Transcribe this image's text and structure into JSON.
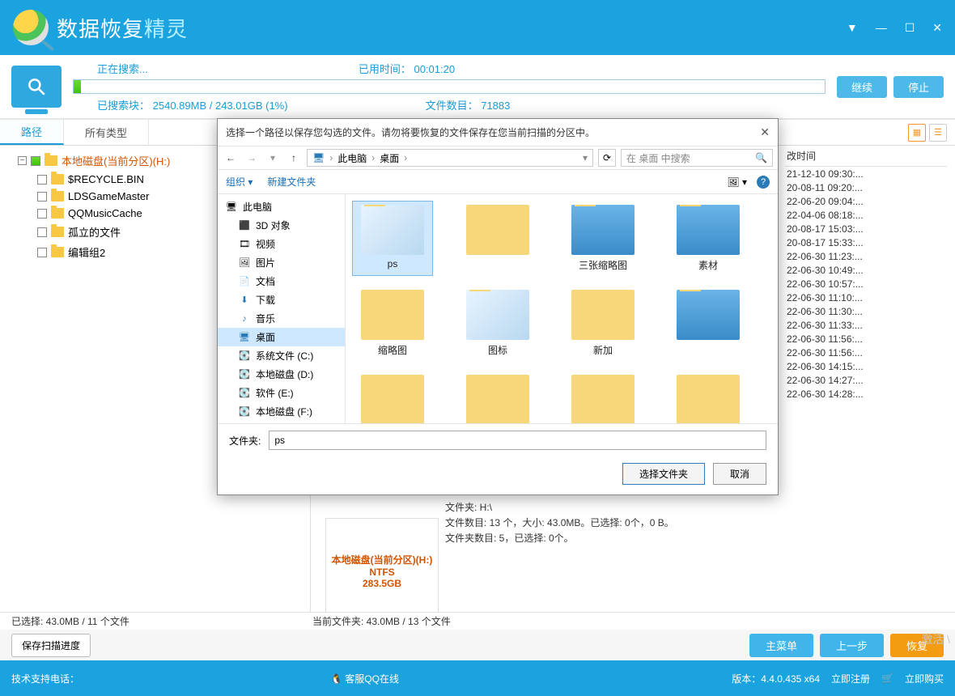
{
  "titlebar": {
    "app_name_a": "数据恢复",
    "app_name_b": "精灵"
  },
  "progress": {
    "searching": "正在搜索...",
    "elapsed_lbl": "已用时间：",
    "elapsed_val": "00:01:20",
    "blocks_lbl": "已搜索块：",
    "blocks_val": "2540.89MB / 243.01GB (1%)",
    "files_lbl": "文件数目：",
    "files_val": "71883",
    "btn_continue": "继续",
    "btn_stop": "停止"
  },
  "tabs": {
    "path": "路径",
    "all_types": "所有类型"
  },
  "tree": {
    "root": "本地磁盘(当前分区)(H:)",
    "n1": "$RECYCLE.BIN",
    "n2": "LDSGameMaster",
    "n3": "QQMusicCache",
    "n4": "孤立的文件",
    "n5": "编辑组2"
  },
  "times": {
    "header": "改时间",
    "rows": [
      "21-12-10 09:30:...",
      "20-08-11 09:20:...",
      "22-06-20 09:04:...",
      "22-04-06 08:18:...",
      "20-08-17 15:03:...",
      "20-08-17 15:33:...",
      "22-06-30 11:23:...",
      "22-06-30 10:49:...",
      "22-06-30 10:57:...",
      "22-06-30 11:10:...",
      "22-06-30 11:30:...",
      "22-06-30 11:33:...",
      "22-06-30 11:56:...",
      "22-06-30 11:56:...",
      "22-06-30 14:15:...",
      "22-06-30 14:27:...",
      "22-06-30 14:28:..."
    ]
  },
  "disk_card": {
    "l1": "本地磁盘(当前分区)(H:)",
    "l2": "NTFS",
    "l3": "283.5GB"
  },
  "info": {
    "l1": "文件夹: H:\\",
    "l2": "文件数目: 13 个，大小: 43.0MB。已选择: 0个，0 B。",
    "l3": "文件夹数目: 5，已选择: 0个。"
  },
  "status": {
    "selected": "已选择: 43.0MB / 11 个文件",
    "current": "当前文件夹: 43.0MB / 13 个文件"
  },
  "actions": {
    "save_progress": "保存扫描进度",
    "main_menu": "主菜单",
    "prev": "上一步",
    "recover": "恢复"
  },
  "footer": {
    "tech": "技术支持电话：",
    "qq": "客服QQ在线",
    "version": "版本：4.4.0.435 x64",
    "register": "立即注册",
    "buy": "立即购买",
    "activate": "激活 \\"
  },
  "dialog": {
    "title": "选择一个路径以保存您勾选的文件。请勿将要恢复的文件保存在您当前扫描的分区中。",
    "crumb1": "此电脑",
    "crumb2": "桌面",
    "search_ph": "在 桌面 中搜索",
    "org": "组织",
    "new_folder": "新建文件夹",
    "side": {
      "pc": "此电脑",
      "obj3d": "3D 对象",
      "video": "视频",
      "pic": "图片",
      "doc": "文档",
      "dl": "下载",
      "music": "音乐",
      "desktop": "桌面",
      "c": "系统文件 (C:)",
      "d": "本地磁盘 (D:)",
      "e": "软件 (E:)",
      "f": "本地磁盘 (F:)"
    },
    "files": [
      "ps",
      "",
      "三张缩略图",
      "素材",
      "缩略图",
      "图标",
      "新加",
      "",
      "",
      "",
      "",
      ""
    ],
    "folder_lbl": "文件夹:",
    "folder_val": "ps",
    "ok": "选择文件夹",
    "cancel": "取消"
  }
}
